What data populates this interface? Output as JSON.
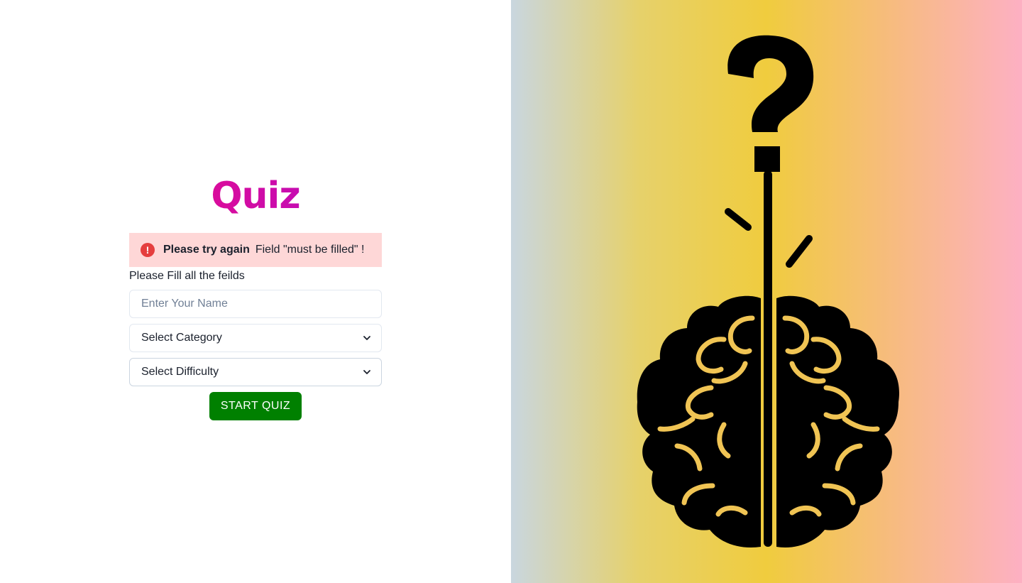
{
  "title": "Quiz",
  "alert": {
    "icon": "!",
    "title": "Please try again",
    "description": "Field \"must be filled\" !"
  },
  "hint": "Please Fill all the feilds",
  "name_input": {
    "placeholder": "Enter Your Name",
    "value": ""
  },
  "category_select": {
    "selected": "Select Category"
  },
  "difficulty_select": {
    "selected": "Select Difficulty"
  },
  "start_button": "START QUIZ",
  "colors": {
    "title_gradient": [
      "#ec0c88",
      "#b40cc4"
    ],
    "alert_bg": "#fed7d7",
    "alert_icon": "#e53e3e",
    "button_bg": "#008000",
    "brain_outline": "#f0c454"
  },
  "icons": {
    "alert": "alert-circle-icon",
    "select_arrow": "chevron-down-icon",
    "illustration": "brain-question-illustration"
  }
}
